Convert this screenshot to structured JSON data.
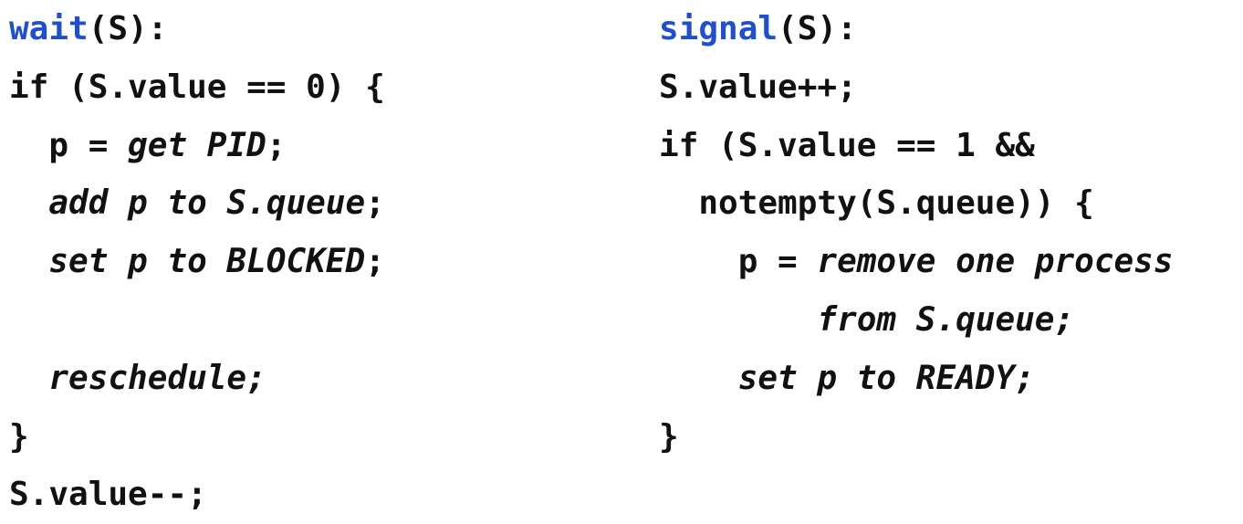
{
  "colors": {
    "keyword": "#1f4fd1",
    "text": "#111111",
    "background": "#ffffff"
  },
  "wait": {
    "lines": [
      {
        "segments": [
          {
            "text": "wait",
            "style": "kw"
          },
          {
            "text": "(S):",
            "style": "n"
          }
        ]
      },
      {
        "segments": [
          {
            "text": "if (S.value == 0) {",
            "style": "n"
          }
        ]
      },
      {
        "segments": [
          {
            "text": "  p = ",
            "style": "n"
          },
          {
            "text": "get PID",
            "style": "it"
          },
          {
            "text": ";",
            "style": "n"
          }
        ]
      },
      {
        "segments": [
          {
            "text": "  ",
            "style": "n"
          },
          {
            "text": "add p to S.queue",
            "style": "it"
          },
          {
            "text": ";",
            "style": "n"
          }
        ]
      },
      {
        "segments": [
          {
            "text": "  ",
            "style": "n"
          },
          {
            "text": "set p to BLOCKED",
            "style": "it"
          },
          {
            "text": ";",
            "style": "n"
          }
        ]
      },
      {
        "segments": [
          {
            "text": "",
            "style": "n"
          }
        ]
      },
      {
        "segments": [
          {
            "text": "  ",
            "style": "n"
          },
          {
            "text": "reschedule;",
            "style": "it"
          }
        ]
      },
      {
        "segments": [
          {
            "text": "}",
            "style": "n"
          }
        ]
      },
      {
        "segments": [
          {
            "text": "S.value--;",
            "style": "n"
          }
        ]
      }
    ]
  },
  "signal": {
    "lines": [
      {
        "segments": [
          {
            "text": "signal",
            "style": "kw"
          },
          {
            "text": "(S):",
            "style": "n"
          }
        ]
      },
      {
        "segments": [
          {
            "text": "S.value++;",
            "style": "n"
          }
        ]
      },
      {
        "segments": [
          {
            "text": "if (S.value == 1 &&",
            "style": "n"
          }
        ]
      },
      {
        "segments": [
          {
            "text": "  notempty(S.queue)) {",
            "style": "n"
          }
        ]
      },
      {
        "segments": [
          {
            "text": "    p = ",
            "style": "n"
          },
          {
            "text": "remove one process",
            "style": "it"
          }
        ]
      },
      {
        "segments": [
          {
            "text": "        ",
            "style": "n"
          },
          {
            "text": "from S.queue;",
            "style": "it"
          }
        ]
      },
      {
        "segments": [
          {
            "text": "    ",
            "style": "n"
          },
          {
            "text": "set p to READY;",
            "style": "it"
          }
        ]
      },
      {
        "segments": [
          {
            "text": "}",
            "style": "n"
          }
        ]
      }
    ]
  }
}
